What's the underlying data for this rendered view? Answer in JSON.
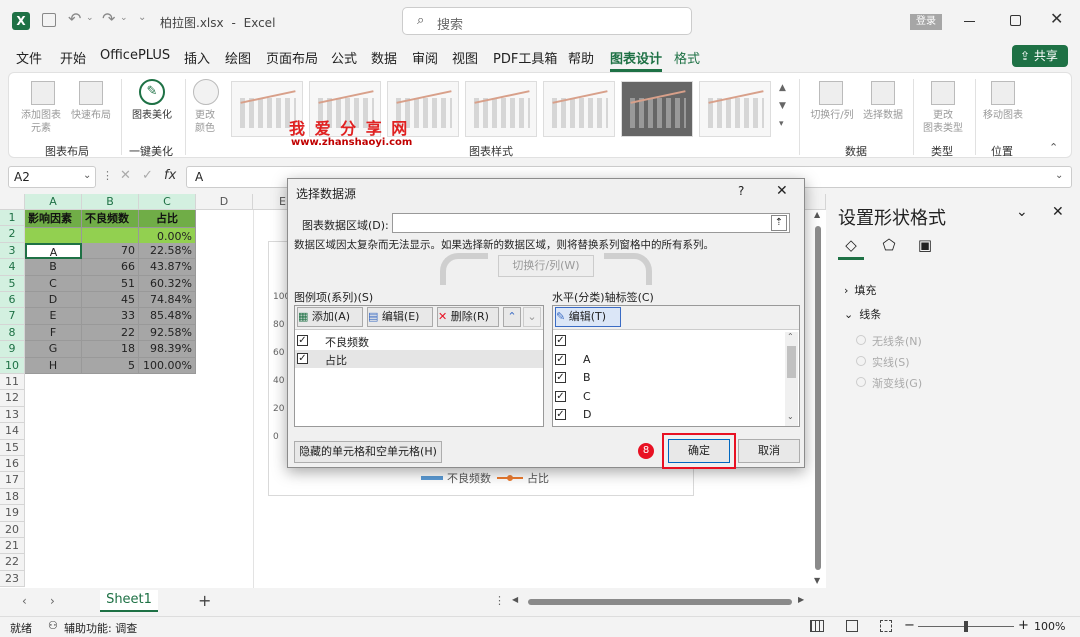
{
  "titlebar": {
    "filename": "柏拉图.xlsx",
    "separator": "-",
    "app": "Excel",
    "search_placeholder": "搜索",
    "login": "登录"
  },
  "menu": {
    "items": [
      "文件",
      "开始",
      "OfficePLUS",
      "插入",
      "绘图",
      "页面布局",
      "公式",
      "数据",
      "审阅",
      "视图",
      "PDF工具箱",
      "帮助",
      "图表设计",
      "格式"
    ],
    "share": "共享"
  },
  "ribbon": {
    "add_element": "添加图表\n元素",
    "quick_layout": "快速布局",
    "beautify": "图表美化",
    "change_color": "更改\n颜色",
    "group_layout": "图表布局",
    "group_beautify": "一键美化",
    "group_styles": "图表样式",
    "switch_rowcol": "切换行/列",
    "select_data": "选择数据",
    "group_data": "数据",
    "change_type": "更改\n图表类型",
    "group_type": "类型",
    "move_chart": "移动图表",
    "group_location": "位置"
  },
  "watermark": {
    "title": "我 爱 分 享 网",
    "url": "www.zhanshaoyi.com"
  },
  "formula": {
    "namebox": "A2",
    "fx": "fx",
    "value": "A"
  },
  "sheet": {
    "columns": [
      "A",
      "B",
      "C",
      "D",
      "E"
    ],
    "rows": [
      "1",
      "2",
      "3",
      "4",
      "5",
      "6",
      "7",
      "8",
      "9",
      "10",
      "11",
      "12",
      "13",
      "14",
      "15",
      "16",
      "17",
      "18",
      "19",
      "20",
      "21",
      "22",
      "23"
    ],
    "headers": [
      "影响因素",
      "不良频数",
      "占比"
    ],
    "row2_pct": "0.00%",
    "data": [
      [
        "A",
        "70",
        "22.58%"
      ],
      [
        "B",
        "66",
        "43.87%"
      ],
      [
        "C",
        "51",
        "60.32%"
      ],
      [
        "D",
        "45",
        "74.84%"
      ],
      [
        "E",
        "33",
        "85.48%"
      ],
      [
        "F",
        "22",
        "92.58%"
      ],
      [
        "G",
        "18",
        "98.39%"
      ],
      [
        "H",
        "5",
        "100.00%"
      ]
    ]
  },
  "chart": {
    "ticks": [
      "100",
      "80",
      "60",
      "40",
      "20",
      "0"
    ],
    "legend": [
      "不良频数",
      "占比"
    ]
  },
  "dialog": {
    "title": "选择数据源",
    "help": "?",
    "range_label": "图表数据区域(D):",
    "note": "数据区域因太复杂而无法显示。如果选择新的数据区域，则将替换系列窗格中的所有系列。",
    "switch": "切换行/列(W)",
    "legend_label": "图例项(系列)(S)",
    "axis_label": "水平(分类)轴标签(C)",
    "add": "添加(A)",
    "edit": "编辑(E)",
    "delete": "删除(R)",
    "edit_axis": "编辑(T)",
    "series": [
      "不良频数",
      "占比"
    ],
    "categories": [
      "",
      "A",
      "B",
      "C",
      "D"
    ],
    "hidden_cells": "隐藏的单元格和空单元格(H)",
    "step": "8",
    "ok": "确定",
    "cancel": "取消"
  },
  "sidepanel": {
    "title": "设置形状格式",
    "fill": "填充",
    "line": "线条",
    "options": [
      "无线条(N)",
      "实线(S)",
      "渐变线(G)"
    ]
  },
  "tabs": {
    "sheet": "Sheet1",
    "add": "+"
  },
  "status": {
    "ready": "就绪",
    "accessibility": "辅助功能: 调查",
    "zoom": "100%"
  },
  "colors": {
    "excel_green": "#1e7145",
    "header_fill": "#70ad47",
    "data_gray": "#a6a6a6",
    "highlight_red": "#e81123",
    "series_blue": "#5b9bd5",
    "series_orange": "#ed7d31"
  }
}
